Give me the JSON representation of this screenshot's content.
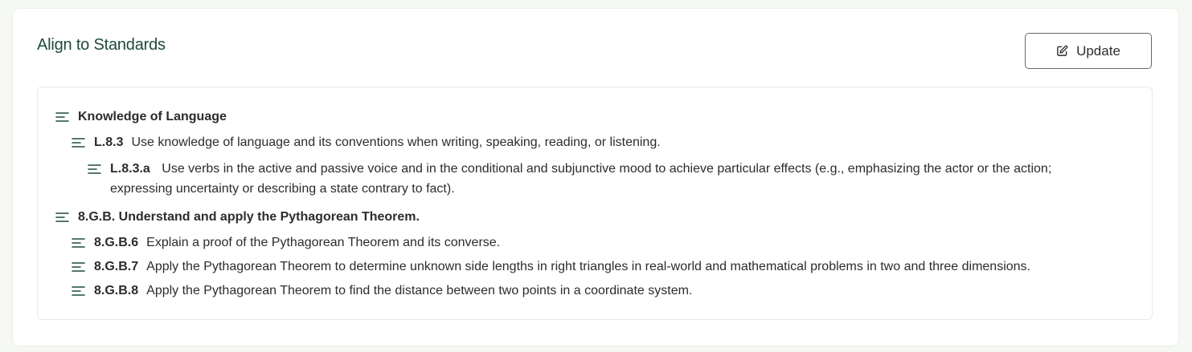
{
  "header": {
    "title": "Align to Standards",
    "update_label": "Update"
  },
  "icons": {
    "update": "edit-icon",
    "tree_item": "align-left-icon"
  },
  "colors": {
    "title": "#1f4a3a",
    "text": "#2a2d2c",
    "icon": "#1f4a3a",
    "button_border": "#5f6b66"
  },
  "standards": {
    "group1": {
      "heading": "Knowledge of Language",
      "item1": {
        "code": "L.8.3",
        "desc": "Use knowledge of language and its conventions when writing, speaking, reading, or listening."
      },
      "item1a": {
        "code": "L.8.3.a",
        "desc": "Use verbs in the active and passive voice and in the conditional and subjunctive mood to achieve particular effects (e.g., emphasizing the actor or the action; expressing uncertainty or describing a state contrary to fact)."
      }
    },
    "group2": {
      "heading": "8.G.B. Understand and apply the Pythagorean Theorem.",
      "item6": {
        "code": "8.G.B.6",
        "desc": "Explain a proof of the Pythagorean Theorem and its converse."
      },
      "item7": {
        "code": "8.G.B.7",
        "desc": "Apply the Pythagorean Theorem to determine unknown side lengths in right triangles in real-world and mathematical problems in two and three dimensions."
      },
      "item8": {
        "code": "8.G.B.8",
        "desc": "Apply the Pythagorean Theorem to find the distance between two points in a coordinate system."
      }
    }
  }
}
